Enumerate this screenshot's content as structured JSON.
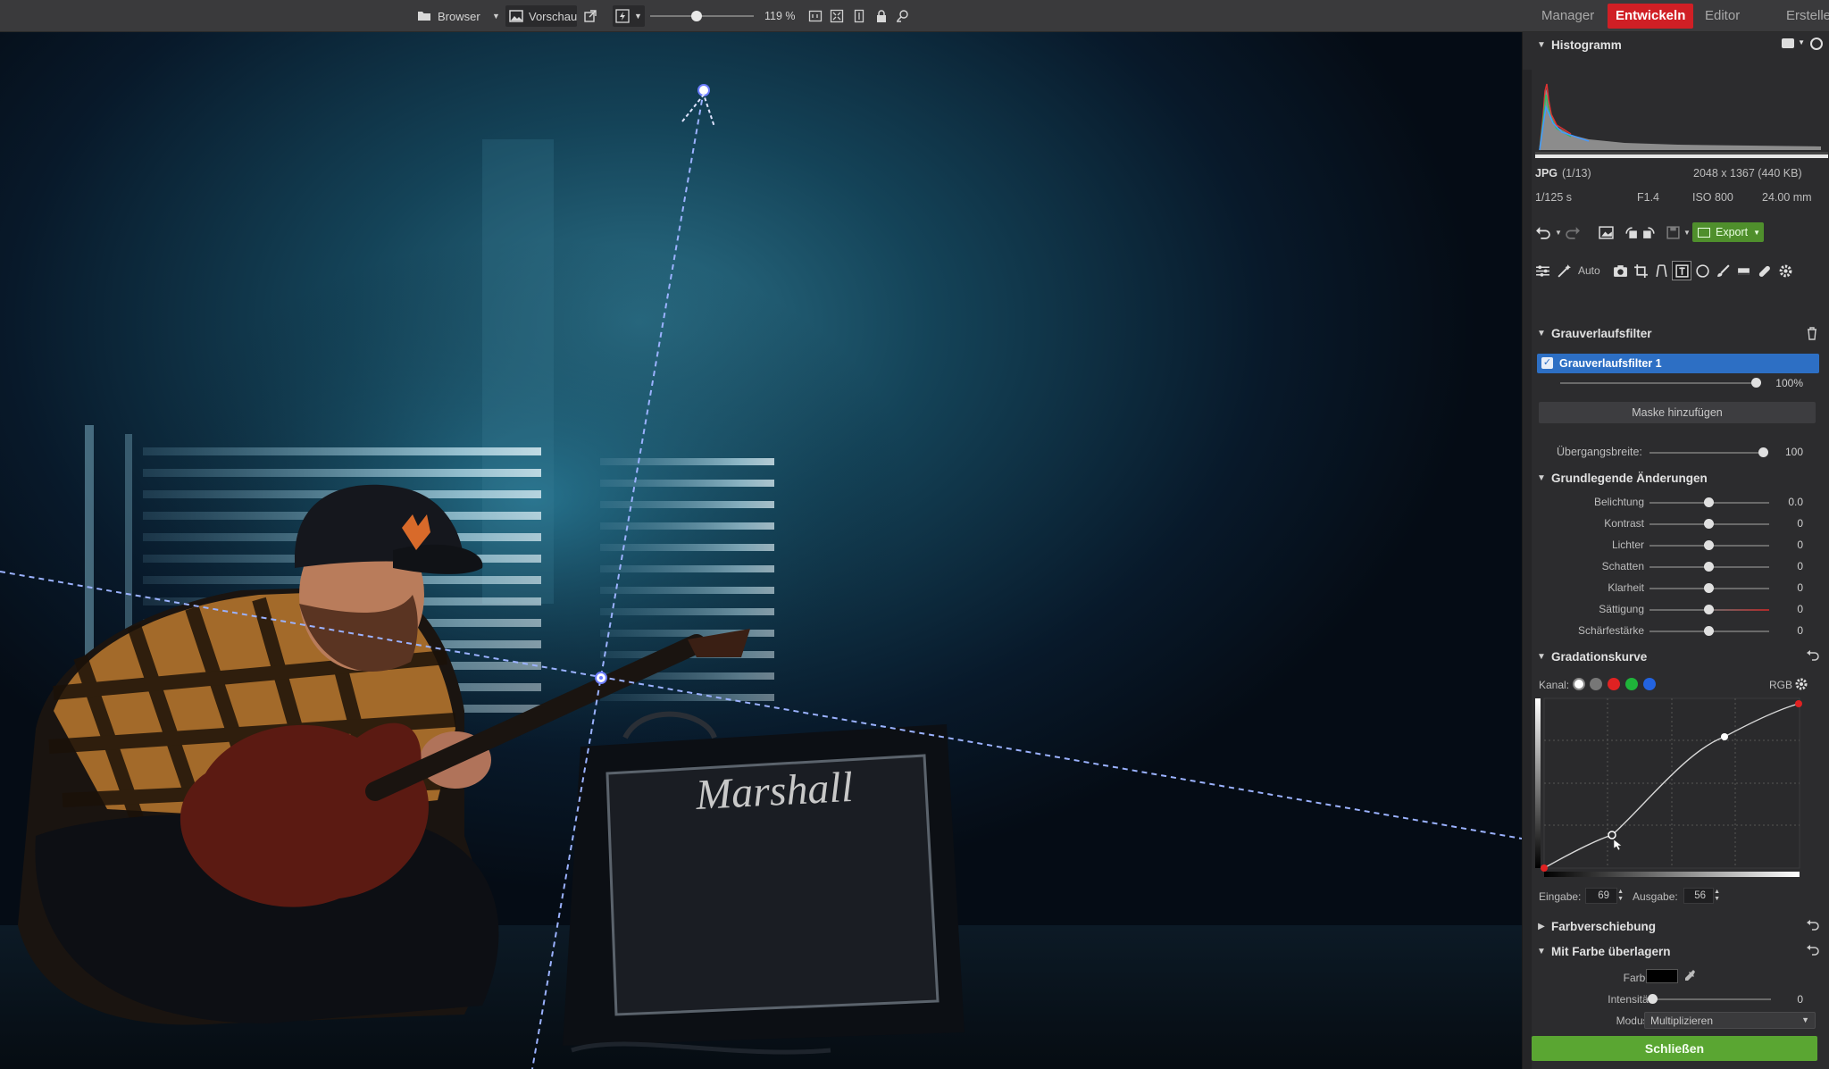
{
  "toolbar": {
    "browser_label": "Browser",
    "preview_label": "Vorschau",
    "zoom_value": "119 %",
    "zoom_level": 0.45
  },
  "modes": {
    "manager": "Manager",
    "develop": "Entwickeln",
    "editor": "Editor",
    "create": "Erstellen"
  },
  "histogram": {
    "title": "Histogramm",
    "format": "JPG",
    "index": "(1/13)",
    "dimensions": "2048 x 1367 (440 KB)",
    "shutter": "1/125 s",
    "aperture": "F1.4",
    "iso": "ISO 800",
    "focal": "24.00 mm"
  },
  "actions": {
    "export_label": "Export",
    "auto_label": "Auto"
  },
  "gradient_filter": {
    "title": "Grauverlaufsfilter",
    "item_label": "Grauverlaufsfilter 1",
    "opacity_value": "100%",
    "opacity": 1.0,
    "add_mask_label": "Maske hinzufügen",
    "transition_label": "Übergangsbreite:",
    "transition_value": "100",
    "transition": 1.0
  },
  "basic": {
    "title": "Grundlegende Änderungen",
    "rows": [
      {
        "label": "Belichtung",
        "value": "0.0"
      },
      {
        "label": "Kontrast",
        "value": "0"
      },
      {
        "label": "Lichter",
        "value": "0"
      },
      {
        "label": "Schatten",
        "value": "0"
      },
      {
        "label": "Klarheit",
        "value": "0"
      },
      {
        "label": "Sättigung",
        "value": "0"
      },
      {
        "label": "Schärfestärke",
        "value": "0"
      }
    ]
  },
  "curve": {
    "title": "Gradationskurve",
    "channel_label": "Kanal:",
    "channel_mode": "RGB",
    "input_label": "Eingabe:",
    "input_value": "69",
    "output_label": "Ausgabe:",
    "output_value": "56"
  },
  "color_shift": {
    "title": "Farbverschiebung"
  },
  "overlay": {
    "title": "Mit Farbe überlagern",
    "color_label": "Farbe",
    "color_value": "#000000",
    "intensity_label": "Intensität",
    "intensity_value": "0",
    "mode_label": "Modus:",
    "mode_value": "Multiplizieren"
  },
  "close_label": "Schließen",
  "photo": {
    "amp_brand": "Marshall"
  },
  "colors": {
    "accent_red": "#d01f25",
    "selected_blue": "#2d6fc4",
    "close_green": "#5aa632",
    "guide_blue": "#8fa8ff"
  }
}
